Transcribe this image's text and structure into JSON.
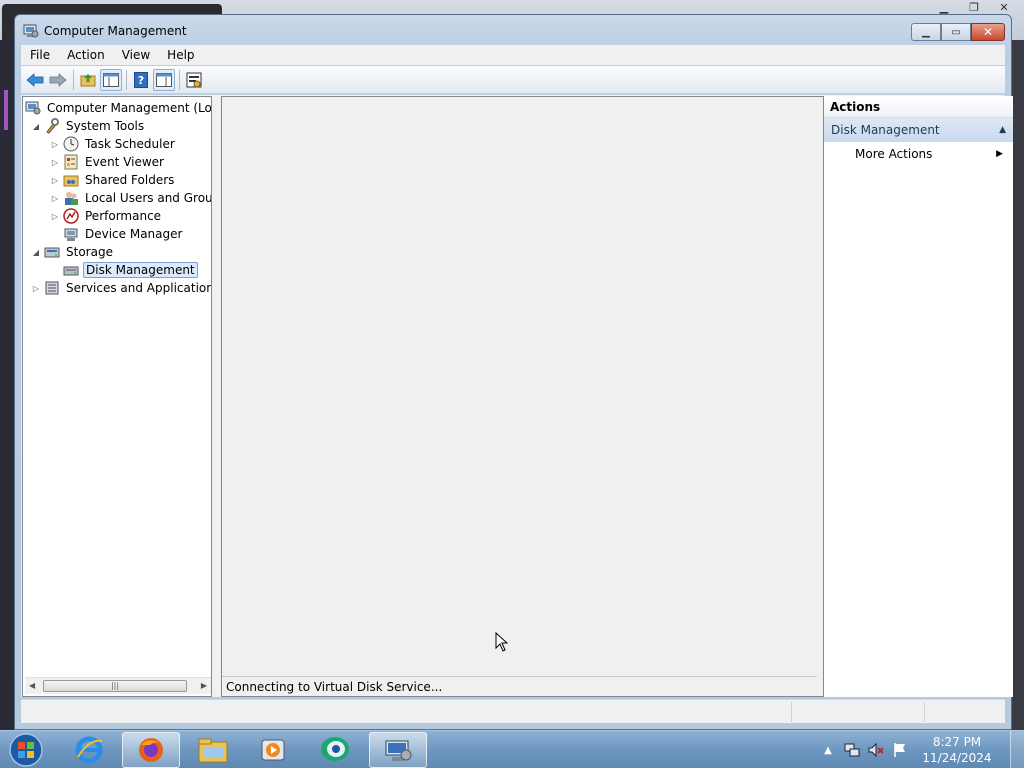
{
  "window": {
    "title": "Computer Management",
    "controls": [
      "minimize",
      "maximize",
      "close"
    ]
  },
  "menubar": {
    "items": [
      "File",
      "Action",
      "View",
      "Help"
    ]
  },
  "toolbar": {
    "buttons": [
      "back-arrow-icon",
      "forward-arrow-icon",
      "up-folder-icon",
      "show-hide-tree-icon",
      "help-icon",
      "show-hide-action-pane-icon",
      "properties-icon"
    ]
  },
  "tree": {
    "items": [
      {
        "label": "Computer Management (Local",
        "expander": "",
        "icon": "computer-management-icon"
      },
      {
        "label": "System Tools",
        "expander": "expanded",
        "icon": "system-tools-icon"
      },
      {
        "label": "Task Scheduler",
        "expander": "collapsed",
        "icon": "clock-icon"
      },
      {
        "label": "Event Viewer",
        "expander": "collapsed",
        "icon": "event-viewer-icon"
      },
      {
        "label": "Shared Folders",
        "expander": "collapsed",
        "icon": "shared-folders-icon"
      },
      {
        "label": "Local Users and Groups",
        "expander": "collapsed",
        "icon": "users-icon"
      },
      {
        "label": "Performance",
        "expander": "collapsed",
        "icon": "performance-icon"
      },
      {
        "label": "Device Manager",
        "expander": "",
        "icon": "device-manager-icon"
      },
      {
        "label": "Storage",
        "expander": "expanded",
        "icon": "storage-icon"
      },
      {
        "label": "Disk Management",
        "expander": "",
        "icon": "disk-management-icon",
        "selected": true
      },
      {
        "label": "Services and Applications",
        "expander": "collapsed",
        "icon": "services-icon"
      }
    ]
  },
  "main": {
    "status": "Connecting to Virtual Disk Service..."
  },
  "actions": {
    "header": "Actions",
    "section": "Disk Management",
    "items": [
      "More Actions"
    ]
  },
  "taskbar": {
    "apps": [
      "internet-explorer-icon",
      "firefox-icon",
      "file-explorer-icon",
      "media-player-icon",
      "chat-app-icon",
      "computer-management-icon"
    ],
    "active_app": "computer-management-icon",
    "time": "8:27 PM",
    "date": "11/24/2024"
  }
}
